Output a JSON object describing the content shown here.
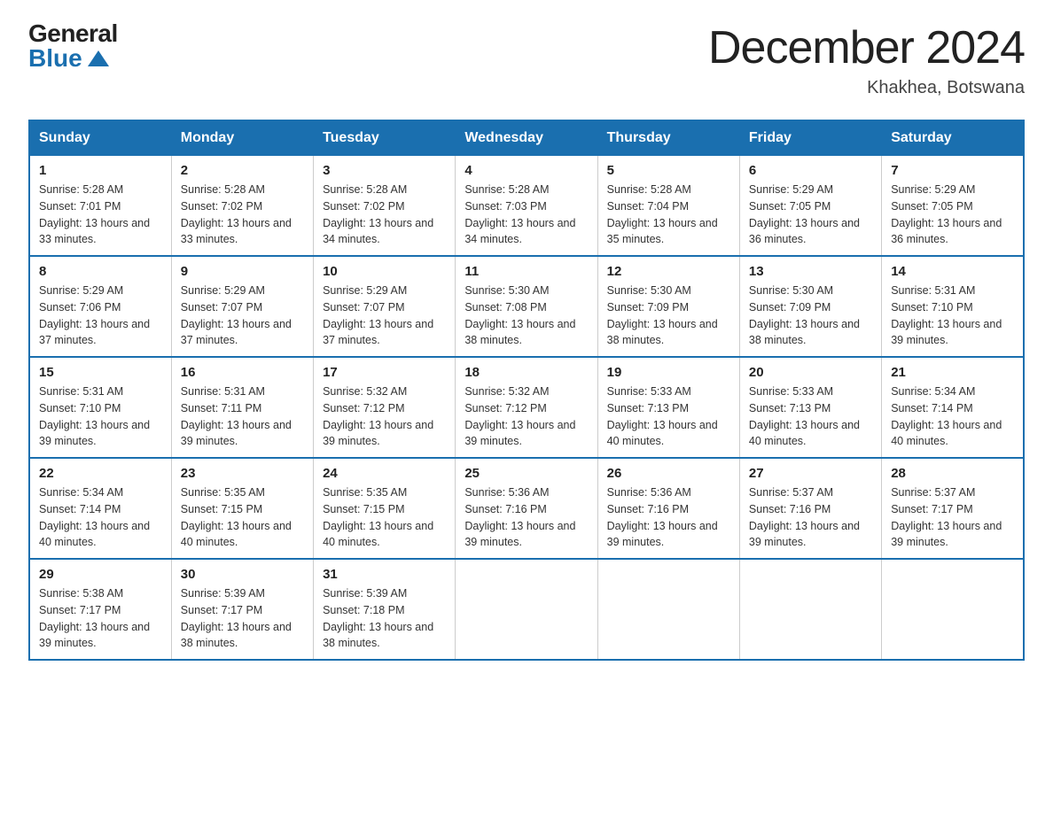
{
  "logo": {
    "general": "General",
    "blue": "Blue"
  },
  "title": "December 2024",
  "location": "Khakhea, Botswana",
  "days_of_week": [
    "Sunday",
    "Monday",
    "Tuesday",
    "Wednesday",
    "Thursday",
    "Friday",
    "Saturday"
  ],
  "weeks": [
    [
      {
        "day": "1",
        "sunrise": "5:28 AM",
        "sunset": "7:01 PM",
        "daylight": "13 hours and 33 minutes."
      },
      {
        "day": "2",
        "sunrise": "5:28 AM",
        "sunset": "7:02 PM",
        "daylight": "13 hours and 33 minutes."
      },
      {
        "day": "3",
        "sunrise": "5:28 AM",
        "sunset": "7:02 PM",
        "daylight": "13 hours and 34 minutes."
      },
      {
        "day": "4",
        "sunrise": "5:28 AM",
        "sunset": "7:03 PM",
        "daylight": "13 hours and 34 minutes."
      },
      {
        "day": "5",
        "sunrise": "5:28 AM",
        "sunset": "7:04 PM",
        "daylight": "13 hours and 35 minutes."
      },
      {
        "day": "6",
        "sunrise": "5:29 AM",
        "sunset": "7:05 PM",
        "daylight": "13 hours and 36 minutes."
      },
      {
        "day": "7",
        "sunrise": "5:29 AM",
        "sunset": "7:05 PM",
        "daylight": "13 hours and 36 minutes."
      }
    ],
    [
      {
        "day": "8",
        "sunrise": "5:29 AM",
        "sunset": "7:06 PM",
        "daylight": "13 hours and 37 minutes."
      },
      {
        "day": "9",
        "sunrise": "5:29 AM",
        "sunset": "7:07 PM",
        "daylight": "13 hours and 37 minutes."
      },
      {
        "day": "10",
        "sunrise": "5:29 AM",
        "sunset": "7:07 PM",
        "daylight": "13 hours and 37 minutes."
      },
      {
        "day": "11",
        "sunrise": "5:30 AM",
        "sunset": "7:08 PM",
        "daylight": "13 hours and 38 minutes."
      },
      {
        "day": "12",
        "sunrise": "5:30 AM",
        "sunset": "7:09 PM",
        "daylight": "13 hours and 38 minutes."
      },
      {
        "day": "13",
        "sunrise": "5:30 AM",
        "sunset": "7:09 PM",
        "daylight": "13 hours and 38 minutes."
      },
      {
        "day": "14",
        "sunrise": "5:31 AM",
        "sunset": "7:10 PM",
        "daylight": "13 hours and 39 minutes."
      }
    ],
    [
      {
        "day": "15",
        "sunrise": "5:31 AM",
        "sunset": "7:10 PM",
        "daylight": "13 hours and 39 minutes."
      },
      {
        "day": "16",
        "sunrise": "5:31 AM",
        "sunset": "7:11 PM",
        "daylight": "13 hours and 39 minutes."
      },
      {
        "day": "17",
        "sunrise": "5:32 AM",
        "sunset": "7:12 PM",
        "daylight": "13 hours and 39 minutes."
      },
      {
        "day": "18",
        "sunrise": "5:32 AM",
        "sunset": "7:12 PM",
        "daylight": "13 hours and 39 minutes."
      },
      {
        "day": "19",
        "sunrise": "5:33 AM",
        "sunset": "7:13 PM",
        "daylight": "13 hours and 40 minutes."
      },
      {
        "day": "20",
        "sunrise": "5:33 AM",
        "sunset": "7:13 PM",
        "daylight": "13 hours and 40 minutes."
      },
      {
        "day": "21",
        "sunrise": "5:34 AM",
        "sunset": "7:14 PM",
        "daylight": "13 hours and 40 minutes."
      }
    ],
    [
      {
        "day": "22",
        "sunrise": "5:34 AM",
        "sunset": "7:14 PM",
        "daylight": "13 hours and 40 minutes."
      },
      {
        "day": "23",
        "sunrise": "5:35 AM",
        "sunset": "7:15 PM",
        "daylight": "13 hours and 40 minutes."
      },
      {
        "day": "24",
        "sunrise": "5:35 AM",
        "sunset": "7:15 PM",
        "daylight": "13 hours and 40 minutes."
      },
      {
        "day": "25",
        "sunrise": "5:36 AM",
        "sunset": "7:16 PM",
        "daylight": "13 hours and 39 minutes."
      },
      {
        "day": "26",
        "sunrise": "5:36 AM",
        "sunset": "7:16 PM",
        "daylight": "13 hours and 39 minutes."
      },
      {
        "day": "27",
        "sunrise": "5:37 AM",
        "sunset": "7:16 PM",
        "daylight": "13 hours and 39 minutes."
      },
      {
        "day": "28",
        "sunrise": "5:37 AM",
        "sunset": "7:17 PM",
        "daylight": "13 hours and 39 minutes."
      }
    ],
    [
      {
        "day": "29",
        "sunrise": "5:38 AM",
        "sunset": "7:17 PM",
        "daylight": "13 hours and 39 minutes."
      },
      {
        "day": "30",
        "sunrise": "5:39 AM",
        "sunset": "7:17 PM",
        "daylight": "13 hours and 38 minutes."
      },
      {
        "day": "31",
        "sunrise": "5:39 AM",
        "sunset": "7:18 PM",
        "daylight": "13 hours and 38 minutes."
      },
      null,
      null,
      null,
      null
    ]
  ]
}
